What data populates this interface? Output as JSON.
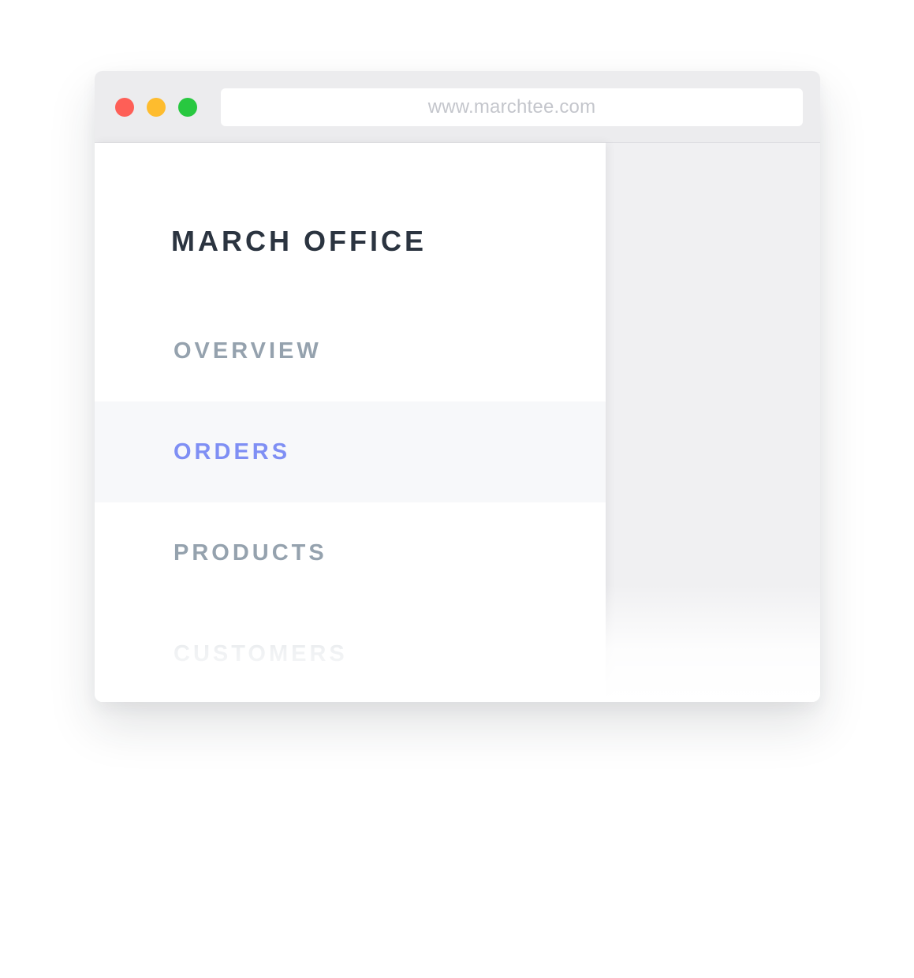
{
  "window": {
    "controls": {
      "close_color": "#fe5f57",
      "minimize_color": "#febc2e",
      "maximize_color": "#28c840"
    },
    "address_bar": {
      "url": "www.marchtee.com"
    }
  },
  "sidebar": {
    "brand": "MARCH OFFICE",
    "items": [
      {
        "label": "OVERVIEW",
        "active": false
      },
      {
        "label": "ORDERS",
        "active": true
      },
      {
        "label": "PRODUCTS",
        "active": false
      },
      {
        "label": "CUSTOMERS",
        "active": false
      }
    ]
  },
  "colors": {
    "accent": "#7f8ff4",
    "nav_text": "#95a2ae",
    "brand_text": "#2b3440",
    "active_row_bg": "#f7f8fa",
    "main_pane_bg": "#f0f0f2"
  }
}
